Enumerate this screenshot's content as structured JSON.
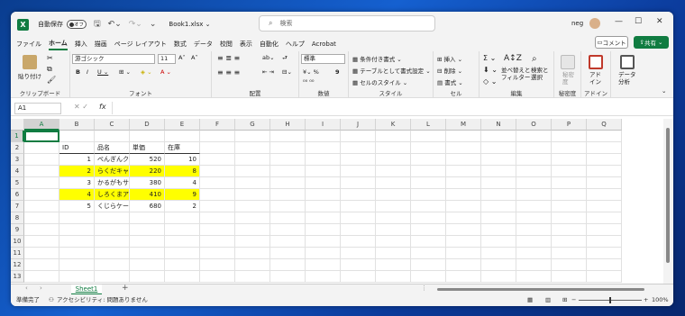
{
  "title_bar": {
    "autosave_label": "自動保存",
    "autosave_state": "オフ",
    "filename": "Book1.xlsx ⌄",
    "search_placeholder": "検索",
    "user": "neg"
  },
  "menu": [
    "ファイル",
    "ホーム",
    "挿入",
    "描画",
    "ページ レイアウト",
    "数式",
    "データ",
    "校閲",
    "表示",
    "自動化",
    "ヘルプ",
    "Acrobat"
  ],
  "actions": {
    "comment": "コメント",
    "share": "共有"
  },
  "ribbon": {
    "clipboard": {
      "paste": "貼り付け",
      "label": "クリップボード"
    },
    "font": {
      "name": "游ゴシック",
      "size": "11",
      "label": "フォント"
    },
    "alignment": {
      "label": "配置"
    },
    "number": {
      "format": "標準",
      "label": "数値"
    },
    "styles": {
      "conditional": "条件付き書式 ⌄",
      "table": "テーブルとして書式設定 ⌄",
      "cell_styles": "セルのスタイル ⌄",
      "label": "スタイル"
    },
    "cells": {
      "insert": "挿入",
      "delete": "削除",
      "format": "書式",
      "label": "セル"
    },
    "editing": {
      "sort": "並べ替えと\nフィルター",
      "find": "検索と\n選択",
      "label": "編集"
    },
    "sensitivity": {
      "btn": "秘密\n度",
      "label": "秘密度"
    },
    "addins": {
      "btn": "アド\nイン",
      "label": "アドイン"
    },
    "analysis": {
      "btn": "データ\n分析",
      "label": ""
    }
  },
  "formula_bar": {
    "name_box": "A1",
    "fx": "fx",
    "value": ""
  },
  "columns": [
    "A",
    "B",
    "C",
    "D",
    "E",
    "F",
    "G",
    "H",
    "I",
    "J",
    "K",
    "L",
    "M",
    "N",
    "O",
    "P",
    "Q"
  ],
  "rows": [
    "1",
    "2",
    "3",
    "4",
    "5",
    "6",
    "7",
    "8",
    "9",
    "10",
    "11",
    "12",
    "13"
  ],
  "table": {
    "headers": [
      "ID",
      "品名",
      "単価",
      "在庫"
    ],
    "rows": [
      {
        "id": "1",
        "name": "ぺんぎんクッキー",
        "price": "520",
        "stock": "10",
        "highlight": false
      },
      {
        "id": "2",
        "name": "らくだキャラメル",
        "price": "220",
        "stock": "8",
        "highlight": true
      },
      {
        "id": "3",
        "name": "かるがもサブレ",
        "price": "380",
        "stock": "4",
        "highlight": false
      },
      {
        "id": "4",
        "name": "しろくまアイス",
        "price": "410",
        "stock": "9",
        "highlight": true
      },
      {
        "id": "5",
        "name": "くじらケーキ",
        "price": "680",
        "stock": "2",
        "highlight": false
      }
    ],
    "highlight_color": "#ffff00"
  },
  "sheet_tabs": [
    "Sheet1"
  ],
  "status": {
    "ready": "準備完了",
    "accessibility": "アクセシビリティ: 問題ありません",
    "zoom": "100%"
  },
  "colors": {
    "accent": "#107c41"
  }
}
